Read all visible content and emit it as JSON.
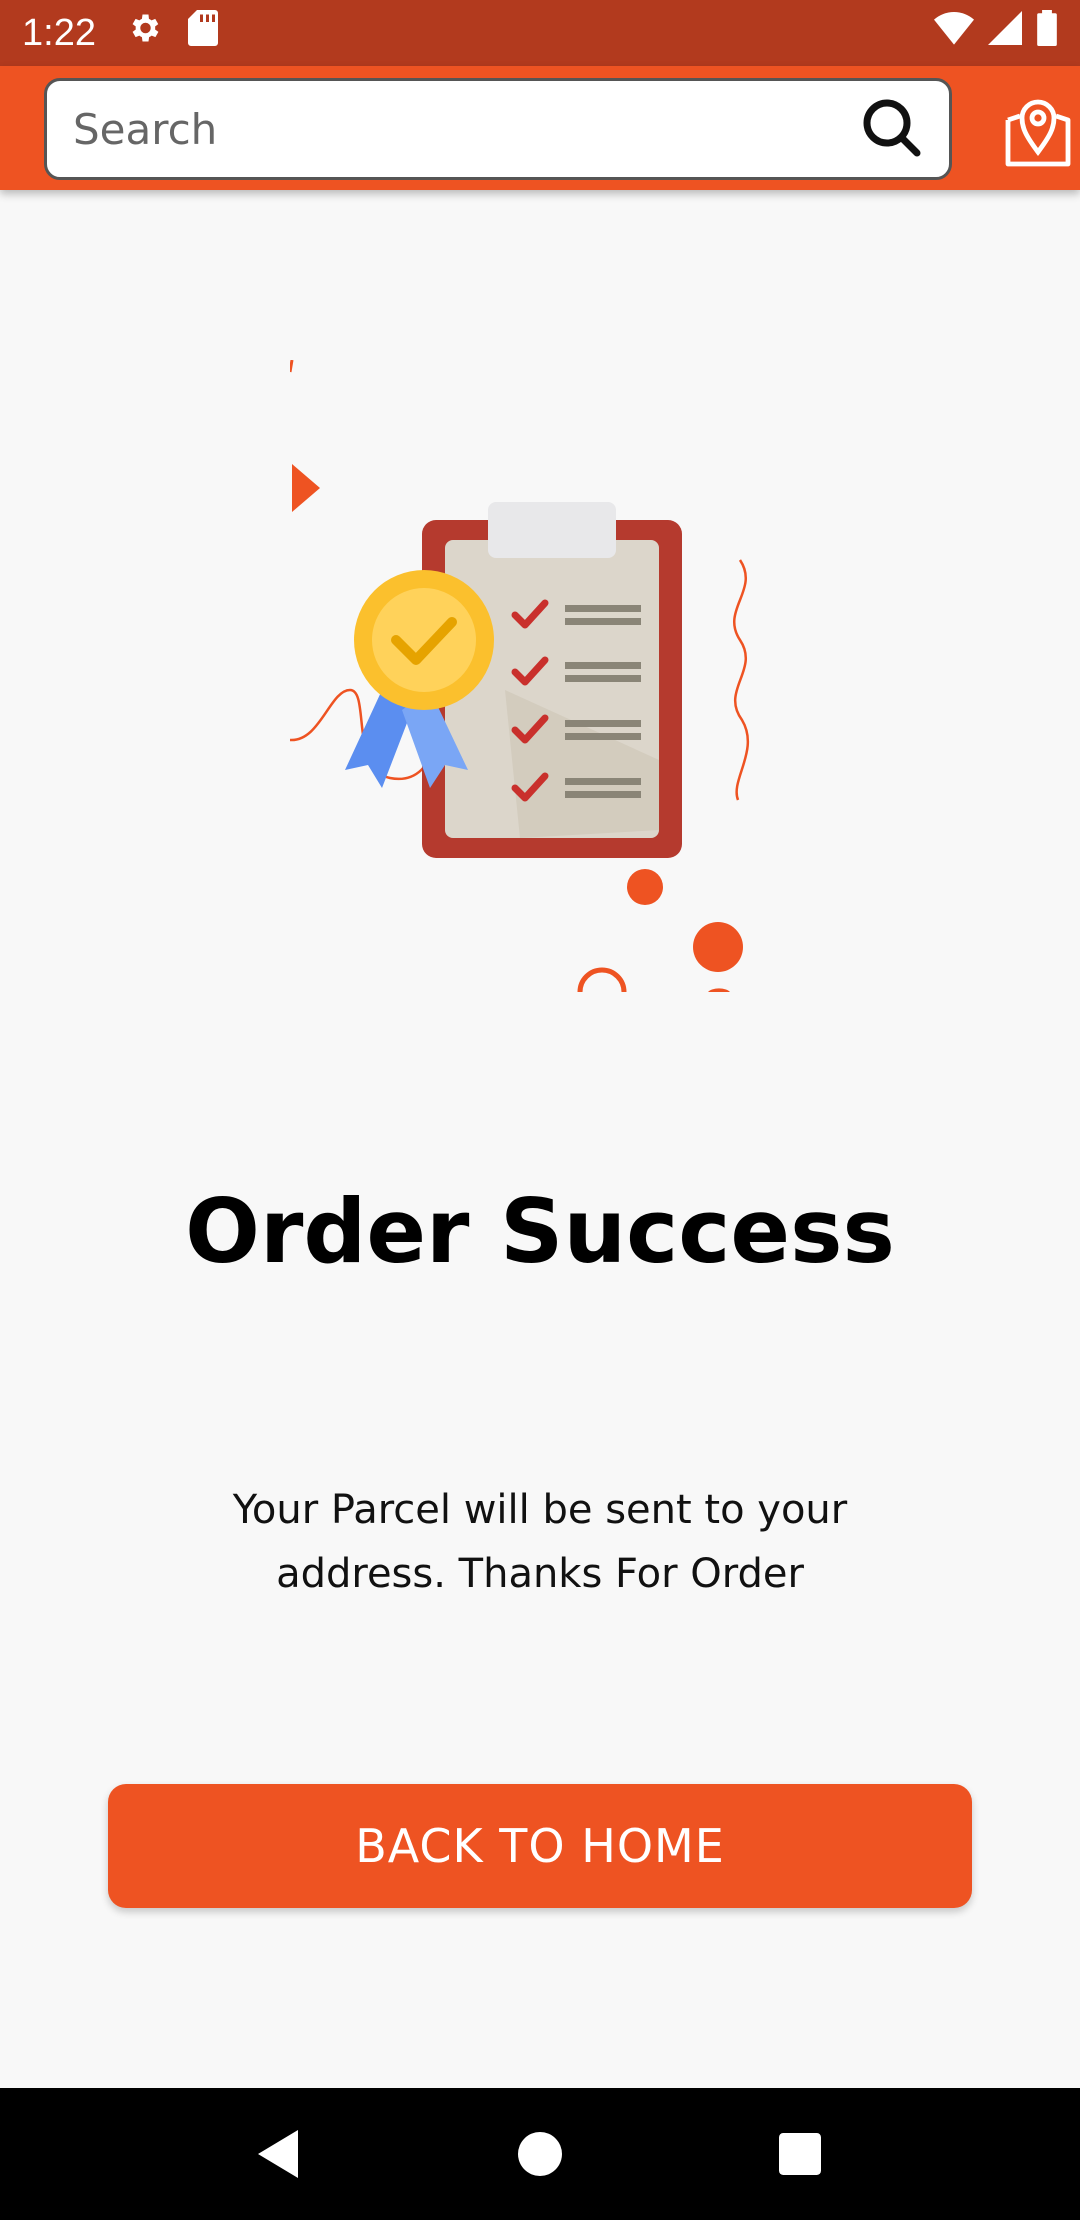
{
  "status_bar": {
    "time": "1:22",
    "icons": [
      "settings-icon",
      "sd-card-icon",
      "wifi-icon",
      "signal-icon",
      "battery-icon"
    ]
  },
  "search": {
    "placeholder": "Search",
    "value": ""
  },
  "app_bar": {
    "actions": [
      "location-icon"
    ]
  },
  "content": {
    "title": "Order Success",
    "message": "Your Parcel will be sent to your address. Thanks For Order",
    "button_label": "BACK TO HOME"
  },
  "nav_bar": {
    "buttons": [
      "back-icon",
      "home-icon",
      "recents-icon"
    ]
  },
  "colors": {
    "status_bar": "#b23a1e",
    "accent": "#ee5322",
    "background": "#f8f8f8"
  }
}
